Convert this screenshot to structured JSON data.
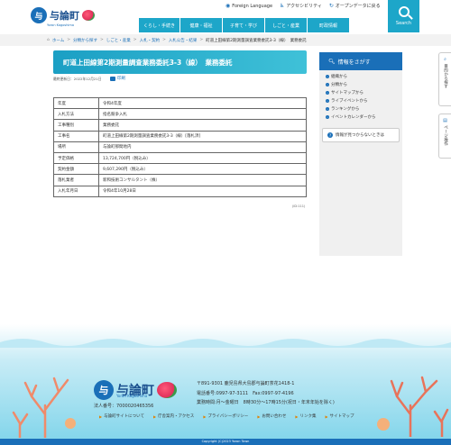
{
  "header": {
    "logo_title": "与論町",
    "logo_subtitle": "Yoron Kagoshima",
    "top_links": {
      "foreign": "Foreign Language",
      "accessibility": "アクセシビリティ",
      "opendata": "オープンデータに戻る"
    },
    "nav": [
      "くらし・手続き",
      "健康・福祉",
      "子育て・学び",
      "しごと・産業",
      "町政情報"
    ],
    "search_label": "Search"
  },
  "breadcrumb": [
    "ホーム",
    "分類から探す",
    "しごと・産業",
    "入札・契約",
    "入札公告・結果",
    "町道上田線第2期測量調査業務委託3-3（線）　業務委託"
  ],
  "main": {
    "title": "町道上田線第2期測量調査業務委託3-3（線）　業務委託",
    "updated": "最終更新日：2022年12月21日",
    "print": "印刷",
    "page_id": "(ID:111)",
    "table": [
      {
        "k": "年度",
        "v": "令和4年度"
      },
      {
        "k": "入札方法",
        "v": "指名競争入札"
      },
      {
        "k": "工事種別",
        "v": "業務委託"
      },
      {
        "k": "工事名",
        "v": "町道上田線第2期測量調査業務委託3-3（線）[落札済]"
      },
      {
        "k": "場所",
        "v": "与論町那間地内"
      },
      {
        "k": "予定価格",
        "v": "13,724,700円（税込み）"
      },
      {
        "k": "契約金額",
        "v": "9,607,290円（税込み）"
      },
      {
        "k": "落札業者",
        "v": "新和技術コンサルタント（株）"
      },
      {
        "k": "入札年月日",
        "v": "令和4年10月28日"
      }
    ]
  },
  "sidebar": {
    "heading": "情報をさがす",
    "items": [
      "組織から",
      "分類から",
      "サイトマップから",
      "ライブイベントから",
      "ランキングから",
      "イベントカレンダーから"
    ],
    "faq": "情報が見つからないときは"
  },
  "right_tabs": {
    "tab1": "目的から探す",
    "tab2": "ページ操作"
  },
  "footer": {
    "logo_title": "与論町",
    "logo_subtitle": "Yoron Kagoshima",
    "corp_num": "法人番号：7000020465356",
    "address": [
      "〒891-9301 鹿児島県大島郡与論町茶花1418-1",
      "電話番号:0997-97-3111　Fax:0997-97-4196",
      "業務時間:月～金曜日　8時30分～17時15分(祝日・年末年始を除く)"
    ],
    "links": [
      "与論町サイトについて",
      "庁舎案内・アクセス",
      "プライバシーポリシー",
      "お問い合わせ",
      "リンク集",
      "サイトマップ"
    ],
    "copyright": "Copyright (C)2023 Yoron Town"
  }
}
